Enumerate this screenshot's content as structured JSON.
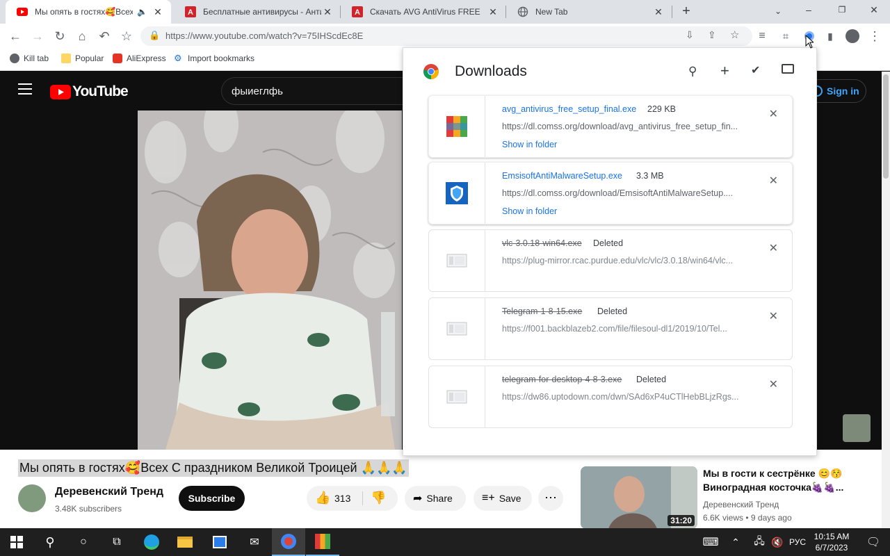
{
  "tabs": [
    {
      "title": "Мы опять в гостях🥰Всех С",
      "active": true
    },
    {
      "title": "Бесплатные антивирусы - Анти",
      "active": false
    },
    {
      "title": "Скачать AVG AntiVirus FREE",
      "active": false
    },
    {
      "title": "New Tab",
      "active": false
    }
  ],
  "address_bar": {
    "url": "https://www.youtube.com/watch?v=75IHScdEc8E"
  },
  "bookmarks": [
    {
      "label": "Kill tab",
      "icon": "kill-tab-icon"
    },
    {
      "label": "Popular",
      "icon": "folder-icon"
    },
    {
      "label": "AliExpress",
      "icon": "aliexpress-icon"
    },
    {
      "label": "Import bookmarks",
      "icon": "gear-icon"
    }
  ],
  "youtube": {
    "logo_text": "YouTube",
    "search_value": "фыиеглфь",
    "sign_in": "Sign in",
    "video_title": "Мы опять в гостях🥰Всех С праздником Великой Троицей 🙏🙏🙏",
    "channel": {
      "name": "Деревенский Тренд",
      "subscribers": "3.48K subscribers"
    },
    "subscribe": "Subscribe",
    "likes": "313",
    "share": "Share",
    "save": "Save",
    "related": {
      "title": "Мы в гости к сестрёнке 😊😚 Виноградная косточка🍇🍇...",
      "channel": "Деревенский Тренд",
      "views": "6.6K views",
      "age": "9 days ago",
      "duration": "31:20"
    }
  },
  "downloads": {
    "title": "Downloads",
    "show_in_folder": "Show in folder",
    "items": [
      {
        "name": "avg_antivirus_free_setup_final.exe",
        "meta": "229 KB",
        "url": "https://dl.comss.org/download/avg_antivirus_free_setup_fin...",
        "deleted": false,
        "icon": "avg-icon"
      },
      {
        "name": "EmsisoftAntiMalwareSetup.exe",
        "meta": "3.3 MB",
        "url": "https://dl.comss.org/download/EmsisoftAntiMalwareSetup....",
        "deleted": false,
        "icon": "shield-icon"
      },
      {
        "name": "vlc-3.0.18-win64.exe",
        "meta": "Deleted",
        "url": "https://plug-mirror.rcac.purdue.edu/vlc/vlc/3.0.18/win64/vlc...",
        "deleted": true,
        "icon": "file-placeholder-icon"
      },
      {
        "name": "Telegram-1-8-15.exe",
        "meta": "Deleted",
        "url": "https://f001.backblazeb2.com/file/filesoul-dl1/2019/10/Tel...",
        "deleted": true,
        "icon": "file-placeholder-icon"
      },
      {
        "name": "telegram-for-desktop-4-8-3.exe",
        "meta": "Deleted",
        "url": "https://dw86.uptodown.com/dwn/SAd6xP4uCTlHebBLjzRgs...",
        "deleted": true,
        "icon": "file-placeholder-icon"
      }
    ]
  },
  "taskbar": {
    "lang": "РУС",
    "time": "10:15 AM",
    "date": "6/7/2023"
  },
  "colors": {
    "youtube_red": "#ff0000",
    "link_blue": "#1a73e8",
    "taskbar": "#1f1f1f"
  }
}
